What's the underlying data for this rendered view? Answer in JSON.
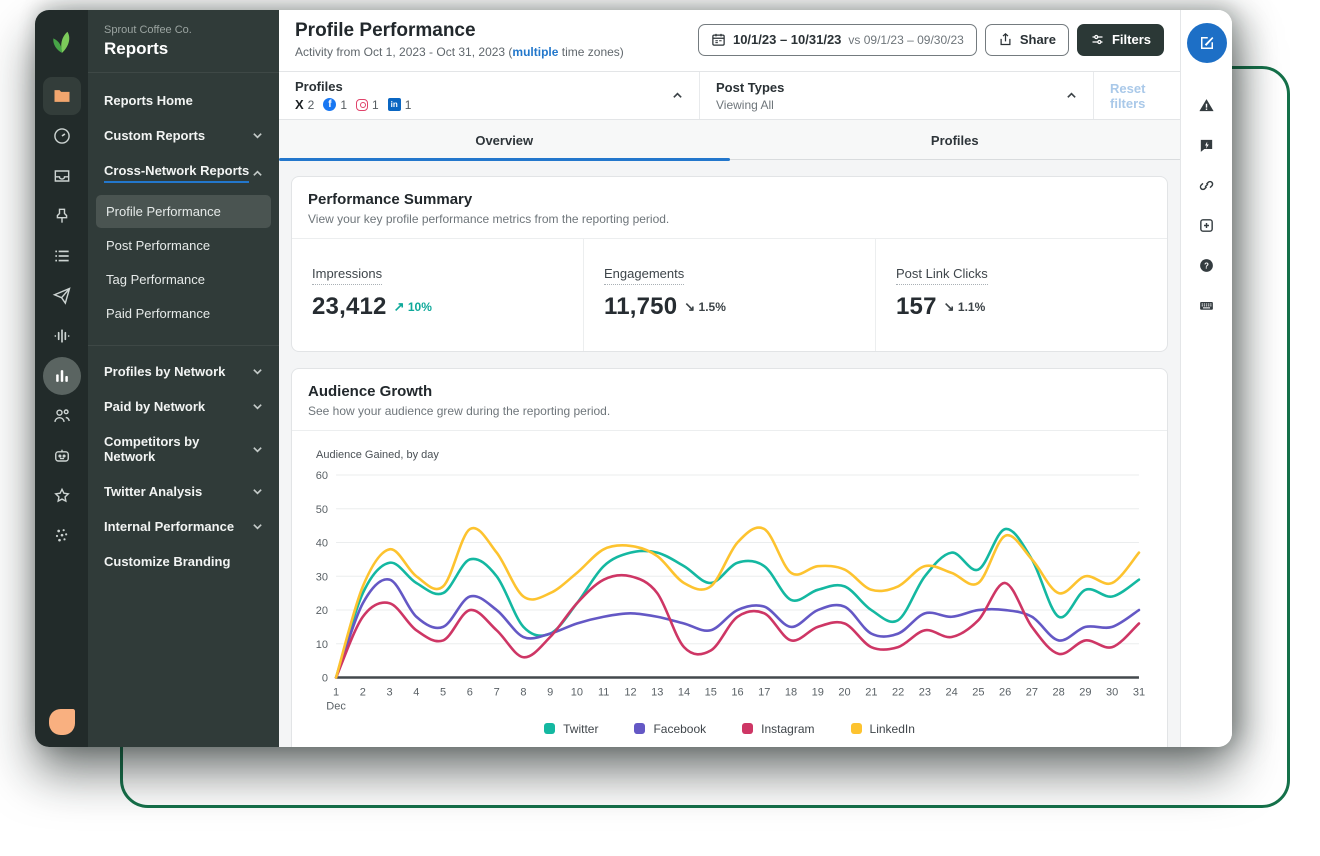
{
  "sidebar": {
    "company": "Sprout Coffee Co.",
    "title": "Reports",
    "reports_home": "Reports Home",
    "custom_reports": "Custom Reports",
    "cross_network": "Cross-Network Reports",
    "sub_items": [
      "Profile Performance",
      "Post Performance",
      "Tag Performance",
      "Paid Performance"
    ],
    "active_sub_item": "Profile Performance",
    "sections": [
      "Profiles by Network",
      "Paid by Network",
      "Competitors by Network",
      "Twitter Analysis",
      "Internal Performance"
    ],
    "customize_branding": "Customize Branding"
  },
  "icons": {
    "left_rail": [
      "sprout-logo",
      "folder",
      "gauge",
      "inbox",
      "pin",
      "list",
      "send",
      "waveform",
      "bar-chart",
      "users",
      "bot",
      "star",
      "dots",
      "leaf"
    ],
    "right_rail": [
      "compose",
      "warning",
      "feedback",
      "link",
      "add",
      "help",
      "keyboard"
    ]
  },
  "header": {
    "title": "Profile Performance",
    "subtitle_prefix": "Activity from Oct 1, 2023 - Oct 31, 2023 (",
    "subtitle_link": "multiple",
    "subtitle_suffix": " time zones)",
    "date_range": "10/1/23 – 10/31/23",
    "date_compare": "vs 09/1/23 – 09/30/23",
    "share_label": "Share",
    "filters_label": "Filters"
  },
  "filter_bar": {
    "profiles_label": "Profiles",
    "profiles": [
      {
        "network": "twitter-x",
        "count": "2"
      },
      {
        "network": "facebook",
        "count": "1"
      },
      {
        "network": "instagram",
        "count": "1"
      },
      {
        "network": "linkedin",
        "count": "1"
      }
    ],
    "post_types_label": "Post Types",
    "post_types_value": "Viewing All",
    "reset_label": "Reset filters"
  },
  "tabs": [
    {
      "label": "Overview",
      "active": true
    },
    {
      "label": "Profiles",
      "active": false
    }
  ],
  "performance_summary": {
    "title": "Performance Summary",
    "subtitle": "View your key profile performance metrics from the reporting period.",
    "metrics": [
      {
        "label": "Impressions",
        "value": "23,412",
        "delta": "10%",
        "direction": "up",
        "arrow": "↗"
      },
      {
        "label": "Engagements",
        "value": "11,750",
        "delta": "1.5%",
        "direction": "down",
        "arrow": "↘"
      },
      {
        "label": "Post Link Clicks",
        "value": "157",
        "delta": "1.1%",
        "direction": "down",
        "arrow": "↘"
      }
    ]
  },
  "audience_growth": {
    "title": "Audience Growth",
    "subtitle": "See how your audience grew during the reporting period."
  },
  "chart_data": {
    "type": "line",
    "title": "Audience Gained, by day",
    "x": [
      1,
      2,
      3,
      4,
      5,
      6,
      7,
      8,
      9,
      10,
      11,
      12,
      13,
      14,
      15,
      16,
      17,
      18,
      19,
      20,
      21,
      22,
      23,
      24,
      25,
      26,
      27,
      28,
      29,
      30,
      31
    ],
    "x_month_note": "Dec",
    "ylim": [
      0,
      60
    ],
    "yticks": [
      0,
      10,
      20,
      30,
      40,
      50,
      60
    ],
    "grid": true,
    "legend_position": "bottom",
    "series": [
      {
        "name": "Twitter",
        "color": "#14b8a1",
        "values": [
          0,
          25,
          34,
          28,
          25,
          35,
          30,
          15,
          13,
          22,
          33,
          37,
          37,
          33,
          28,
          34,
          33,
          23,
          26,
          27,
          20,
          17,
          30,
          37,
          32,
          44,
          35,
          18,
          26,
          24,
          29
        ]
      },
      {
        "name": "Facebook",
        "color": "#6458c5",
        "values": [
          0,
          22,
          29,
          18,
          15,
          24,
          20,
          12,
          13,
          16,
          18,
          19,
          18,
          16,
          14,
          20,
          21,
          15,
          20,
          21,
          13,
          13,
          19,
          18,
          20,
          20,
          18,
          11,
          15,
          15,
          20
        ]
      },
      {
        "name": "Instagram",
        "color": "#ce3665",
        "values": [
          0,
          18,
          22,
          14,
          11,
          20,
          14,
          6,
          12,
          22,
          29,
          30,
          25,
          9,
          8,
          18,
          19,
          11,
          15,
          16,
          9,
          9,
          14,
          12,
          17,
          28,
          15,
          7,
          11,
          9,
          16
        ]
      },
      {
        "name": "LinkedIn",
        "color": "#fdc32f",
        "values": [
          0,
          27,
          38,
          30,
          27,
          44,
          37,
          24,
          25,
          31,
          38,
          39,
          36,
          28,
          27,
          40,
          44,
          31,
          33,
          32,
          26,
          27,
          33,
          31,
          28,
          42,
          35,
          25,
          30,
          28,
          37
        ]
      }
    ]
  },
  "colors": {
    "accent_blue": "#2377cc",
    "teal_up": "#0fa99a",
    "sidebar_bg": "#303b39",
    "rail_bg": "#222b2a",
    "filters_button_bg": "#2b3836",
    "reset_disabled": "#aac9e9",
    "green_outline": "#15714a"
  }
}
